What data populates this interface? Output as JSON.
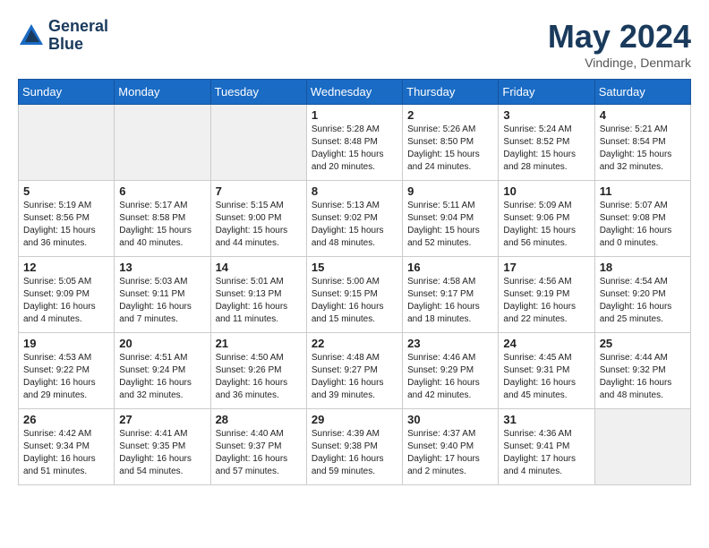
{
  "header": {
    "logo_line1": "General",
    "logo_line2": "Blue",
    "month": "May 2024",
    "location": "Vindinge, Denmark"
  },
  "weekdays": [
    "Sunday",
    "Monday",
    "Tuesday",
    "Wednesday",
    "Thursday",
    "Friday",
    "Saturday"
  ],
  "weeks": [
    [
      {
        "day": "",
        "info": ""
      },
      {
        "day": "",
        "info": ""
      },
      {
        "day": "",
        "info": ""
      },
      {
        "day": "1",
        "info": "Sunrise: 5:28 AM\nSunset: 8:48 PM\nDaylight: 15 hours\nand 20 minutes."
      },
      {
        "day": "2",
        "info": "Sunrise: 5:26 AM\nSunset: 8:50 PM\nDaylight: 15 hours\nand 24 minutes."
      },
      {
        "day": "3",
        "info": "Sunrise: 5:24 AM\nSunset: 8:52 PM\nDaylight: 15 hours\nand 28 minutes."
      },
      {
        "day": "4",
        "info": "Sunrise: 5:21 AM\nSunset: 8:54 PM\nDaylight: 15 hours\nand 32 minutes."
      }
    ],
    [
      {
        "day": "5",
        "info": "Sunrise: 5:19 AM\nSunset: 8:56 PM\nDaylight: 15 hours\nand 36 minutes."
      },
      {
        "day": "6",
        "info": "Sunrise: 5:17 AM\nSunset: 8:58 PM\nDaylight: 15 hours\nand 40 minutes."
      },
      {
        "day": "7",
        "info": "Sunrise: 5:15 AM\nSunset: 9:00 PM\nDaylight: 15 hours\nand 44 minutes."
      },
      {
        "day": "8",
        "info": "Sunrise: 5:13 AM\nSunset: 9:02 PM\nDaylight: 15 hours\nand 48 minutes."
      },
      {
        "day": "9",
        "info": "Sunrise: 5:11 AM\nSunset: 9:04 PM\nDaylight: 15 hours\nand 52 minutes."
      },
      {
        "day": "10",
        "info": "Sunrise: 5:09 AM\nSunset: 9:06 PM\nDaylight: 15 hours\nand 56 minutes."
      },
      {
        "day": "11",
        "info": "Sunrise: 5:07 AM\nSunset: 9:08 PM\nDaylight: 16 hours\nand 0 minutes."
      }
    ],
    [
      {
        "day": "12",
        "info": "Sunrise: 5:05 AM\nSunset: 9:09 PM\nDaylight: 16 hours\nand 4 minutes."
      },
      {
        "day": "13",
        "info": "Sunrise: 5:03 AM\nSunset: 9:11 PM\nDaylight: 16 hours\nand 7 minutes."
      },
      {
        "day": "14",
        "info": "Sunrise: 5:01 AM\nSunset: 9:13 PM\nDaylight: 16 hours\nand 11 minutes."
      },
      {
        "day": "15",
        "info": "Sunrise: 5:00 AM\nSunset: 9:15 PM\nDaylight: 16 hours\nand 15 minutes."
      },
      {
        "day": "16",
        "info": "Sunrise: 4:58 AM\nSunset: 9:17 PM\nDaylight: 16 hours\nand 18 minutes."
      },
      {
        "day": "17",
        "info": "Sunrise: 4:56 AM\nSunset: 9:19 PM\nDaylight: 16 hours\nand 22 minutes."
      },
      {
        "day": "18",
        "info": "Sunrise: 4:54 AM\nSunset: 9:20 PM\nDaylight: 16 hours\nand 25 minutes."
      }
    ],
    [
      {
        "day": "19",
        "info": "Sunrise: 4:53 AM\nSunset: 9:22 PM\nDaylight: 16 hours\nand 29 minutes."
      },
      {
        "day": "20",
        "info": "Sunrise: 4:51 AM\nSunset: 9:24 PM\nDaylight: 16 hours\nand 32 minutes."
      },
      {
        "day": "21",
        "info": "Sunrise: 4:50 AM\nSunset: 9:26 PM\nDaylight: 16 hours\nand 36 minutes."
      },
      {
        "day": "22",
        "info": "Sunrise: 4:48 AM\nSunset: 9:27 PM\nDaylight: 16 hours\nand 39 minutes."
      },
      {
        "day": "23",
        "info": "Sunrise: 4:46 AM\nSunset: 9:29 PM\nDaylight: 16 hours\nand 42 minutes."
      },
      {
        "day": "24",
        "info": "Sunrise: 4:45 AM\nSunset: 9:31 PM\nDaylight: 16 hours\nand 45 minutes."
      },
      {
        "day": "25",
        "info": "Sunrise: 4:44 AM\nSunset: 9:32 PM\nDaylight: 16 hours\nand 48 minutes."
      }
    ],
    [
      {
        "day": "26",
        "info": "Sunrise: 4:42 AM\nSunset: 9:34 PM\nDaylight: 16 hours\nand 51 minutes."
      },
      {
        "day": "27",
        "info": "Sunrise: 4:41 AM\nSunset: 9:35 PM\nDaylight: 16 hours\nand 54 minutes."
      },
      {
        "day": "28",
        "info": "Sunrise: 4:40 AM\nSunset: 9:37 PM\nDaylight: 16 hours\nand 57 minutes."
      },
      {
        "day": "29",
        "info": "Sunrise: 4:39 AM\nSunset: 9:38 PM\nDaylight: 16 hours\nand 59 minutes."
      },
      {
        "day": "30",
        "info": "Sunrise: 4:37 AM\nSunset: 9:40 PM\nDaylight: 17 hours\nand 2 minutes."
      },
      {
        "day": "31",
        "info": "Sunrise: 4:36 AM\nSunset: 9:41 PM\nDaylight: 17 hours\nand 4 minutes."
      },
      {
        "day": "",
        "info": ""
      }
    ]
  ]
}
